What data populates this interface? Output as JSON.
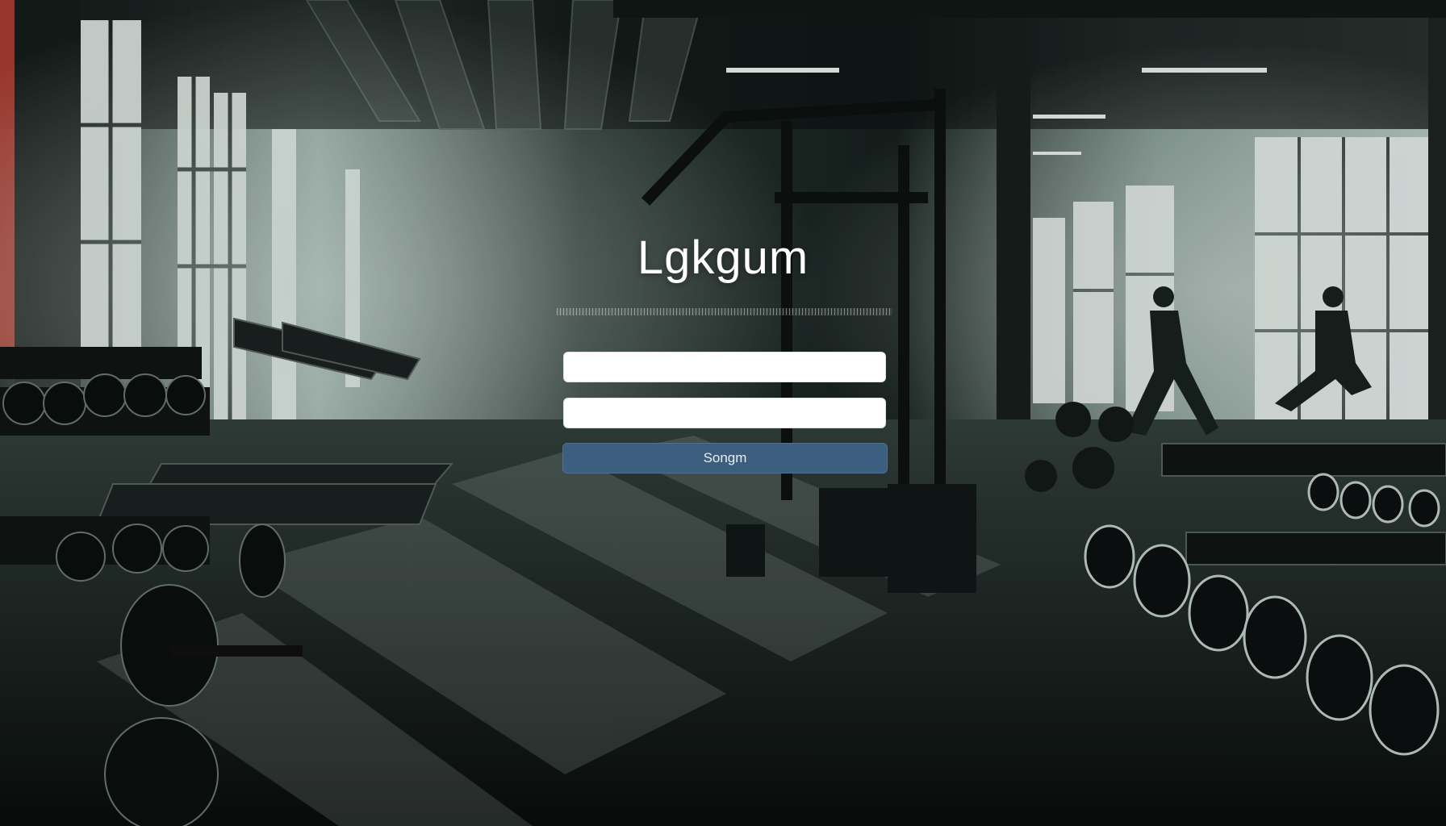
{
  "login": {
    "title": "Lgkgum",
    "username_value": "",
    "password_value": "",
    "submit_label": "Songm"
  },
  "theme": {
    "button_color": "#3c5f80",
    "field_color": "#ffffff",
    "title_color": "#ffffff"
  }
}
